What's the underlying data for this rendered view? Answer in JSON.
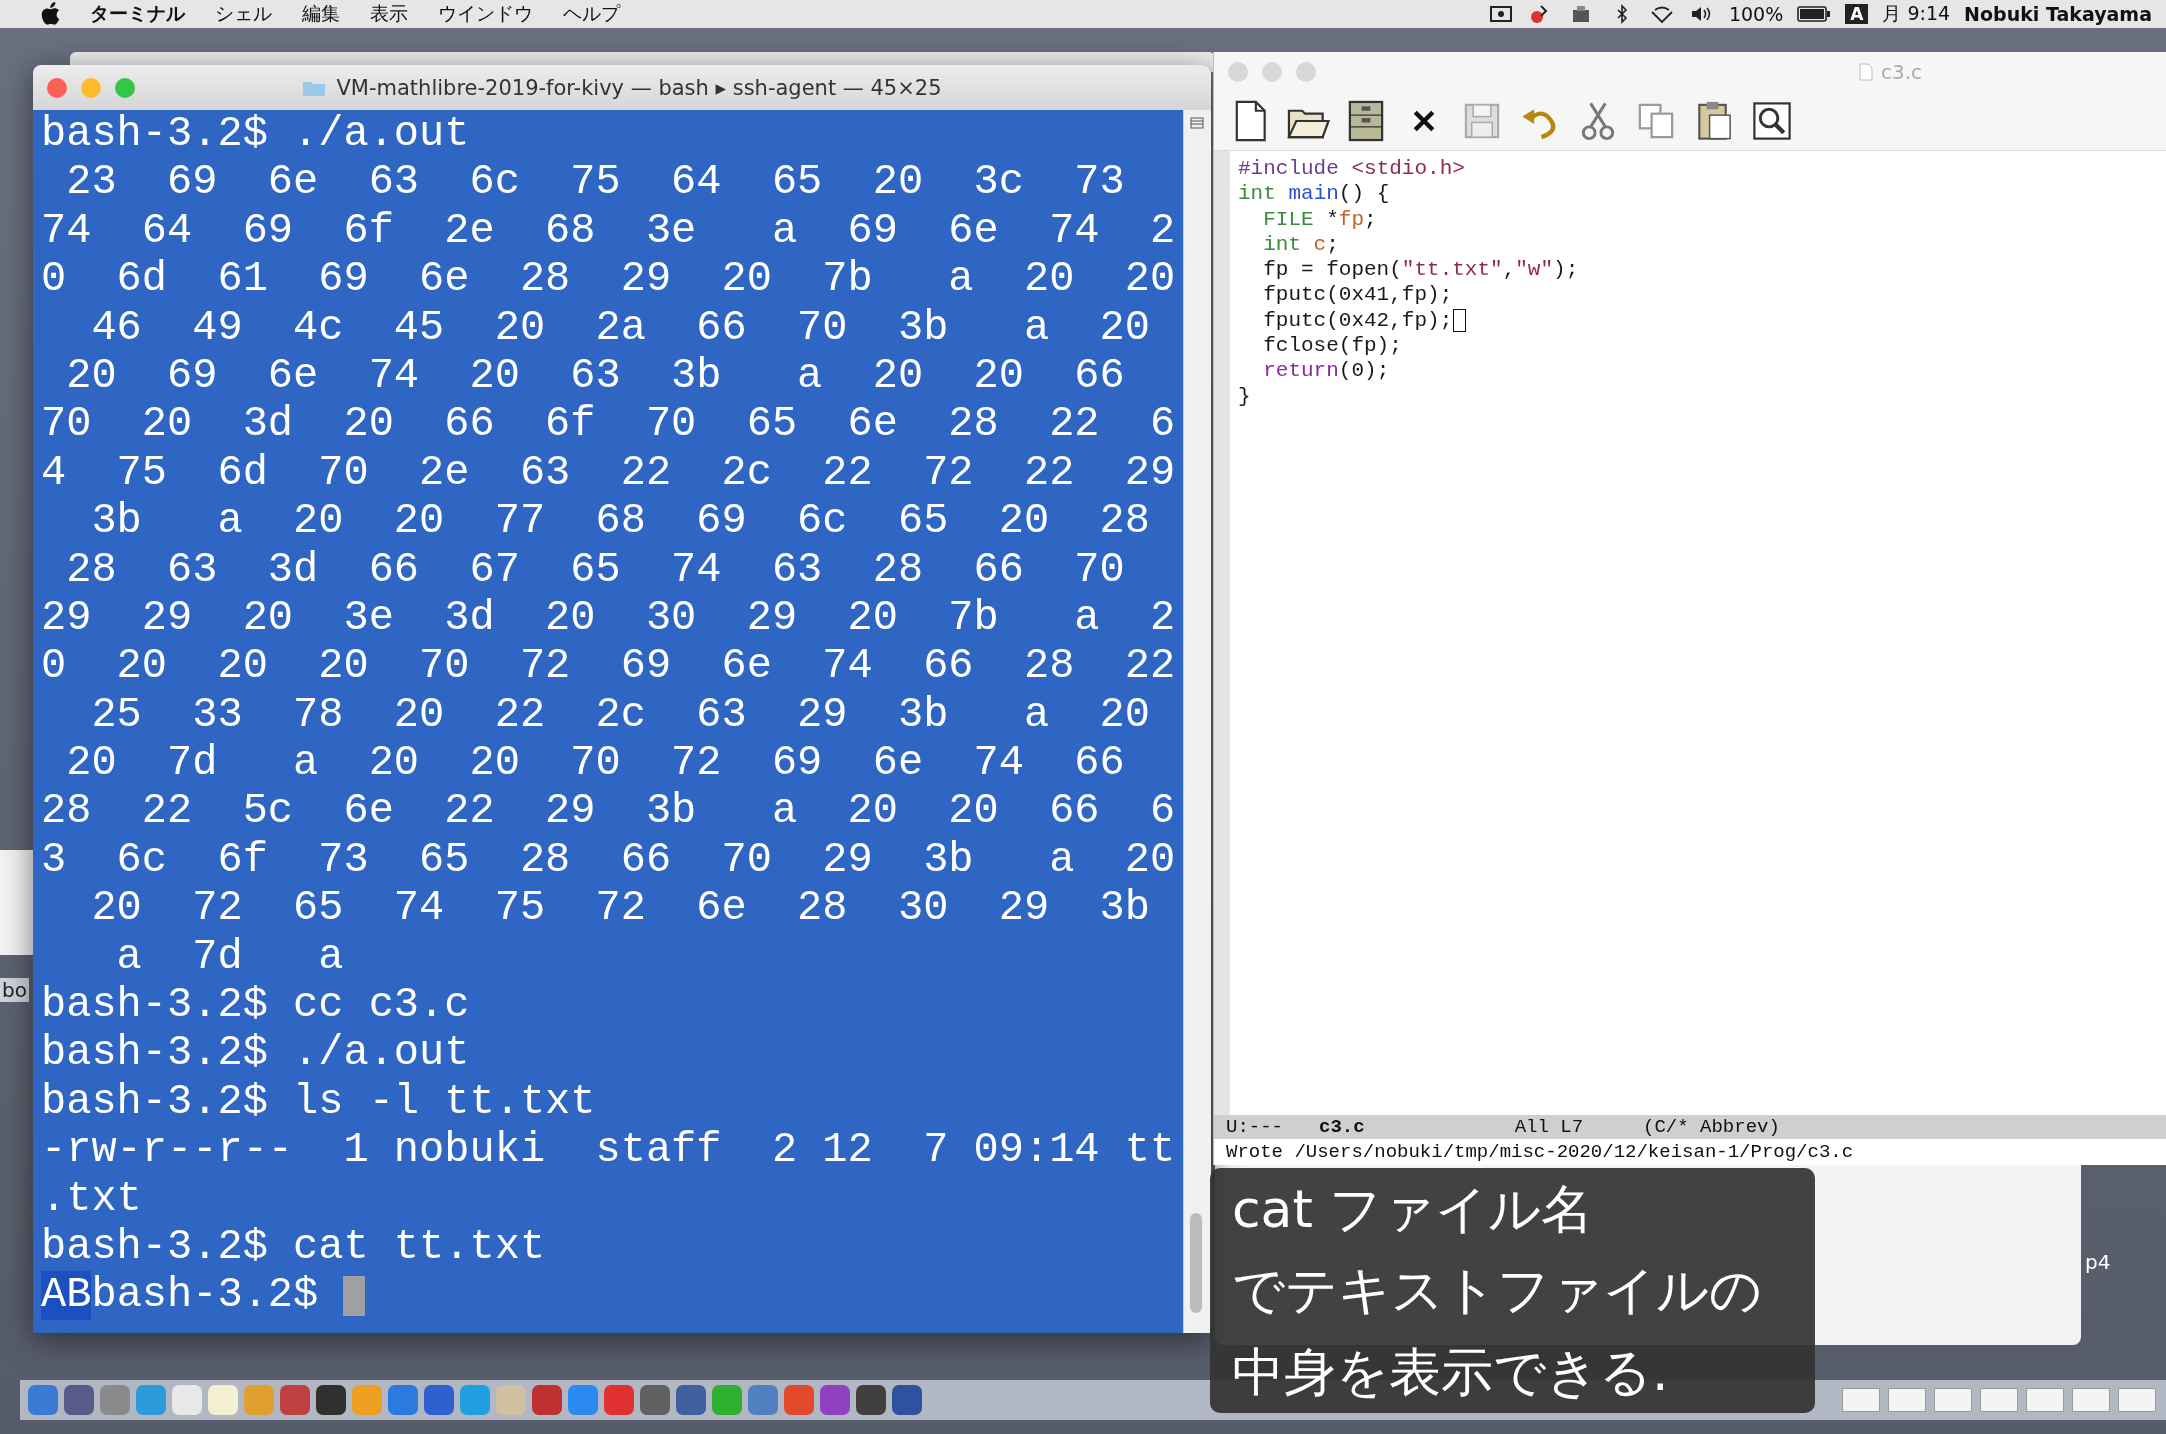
{
  "menu_bar": {
    "app_name": "ターミナル",
    "menus": [
      "シェル",
      "編集",
      "表示",
      "ウインドウ",
      "ヘルプ"
    ],
    "battery": "100%",
    "input_mode": "A",
    "clock": "月 9:14",
    "user": "Nobuki Takayama"
  },
  "terminal": {
    "title": "VM-mathlibre-2019-for-kivy — bash ▸ ssh-agent — 45×25",
    "lines": [
      "bash-3.2$ ./a.out",
      " 23  69  6e  63  6c  75  64  65  20  3c  73",
      "74  64  69  6f  2e  68  3e   a  69  6e  74  2",
      "0  6d  61  69  6e  28  29  20  7b   a  20  20",
      "  46  49  4c  45  20  2a  66  70  3b   a  20",
      " 20  69  6e  74  20  63  3b   a  20  20  66",
      "70  20  3d  20  66  6f  70  65  6e  28  22  6",
      "4  75  6d  70  2e  63  22  2c  22  72  22  29",
      "  3b   a  20  20  77  68  69  6c  65  20  28",
      " 28  63  3d  66  67  65  74  63  28  66  70",
      "29  29  20  3e  3d  20  30  29  20  7b   a  2",
      "0  20  20  20  70  72  69  6e  74  66  28  22",
      "  25  33  78  20  22  2c  63  29  3b   a  20",
      " 20  7d   a  20  20  70  72  69  6e  74  66",
      "28  22  5c  6e  22  29  3b   a  20  20  66  6",
      "3  6c  6f  73  65  28  66  70  29  3b   a  20",
      "  20  72  65  74  75  72  6e  28  30  29  3b",
      "   a  7d   a",
      "bash-3.2$ cc c3.c",
      "bash-3.2$ ./a.out",
      "bash-3.2$ ls -l tt.txt",
      "-rw-r--r--  1 nobuki  staff  2 12  7 09:14 tt",
      ".txt",
      "bash-3.2$ cat tt.txt"
    ],
    "input_line": {
      "segments": [
        {
          "text": "AB",
          "selected": true
        },
        {
          "text": "bash-3.2$",
          "selected": false
        }
      ],
      "cursor": true
    }
  },
  "editor": {
    "title": "c3.c",
    "code_lines": [
      {
        "segments": [
          {
            "kind": "preproc",
            "text": "#include "
          },
          {
            "kind": "string",
            "text": "<stdio.h>"
          }
        ],
        "cursor": false
      },
      {
        "segments": [
          {
            "kind": "type",
            "text": "int "
          },
          {
            "kind": "function",
            "text": "main"
          },
          {
            "kind": "plain",
            "text": "() {"
          }
        ],
        "cursor": false
      },
      {
        "segments": [
          {
            "kind": "type",
            "text": "  FILE"
          },
          {
            "kind": "plain",
            "text": " *"
          },
          {
            "kind": "variable",
            "text": "fp"
          },
          {
            "kind": "plain",
            "text": ";"
          }
        ],
        "cursor": false
      },
      {
        "segments": [
          {
            "kind": "type",
            "text": "  int"
          },
          {
            "kind": "variable",
            "text": " c"
          },
          {
            "kind": "plain",
            "text": ";"
          }
        ],
        "cursor": false
      },
      {
        "segments": [
          {
            "kind": "plain",
            "text": "  fp = fopen("
          },
          {
            "kind": "string",
            "text": "\"tt.txt\""
          },
          {
            "kind": "plain",
            "text": ","
          },
          {
            "kind": "string",
            "text": "\"w\""
          },
          {
            "kind": "plain",
            "text": ");"
          }
        ],
        "cursor": false
      },
      {
        "segments": [
          {
            "kind": "plain",
            "text": "  fputc(0x41,fp);"
          }
        ],
        "cursor": false
      },
      {
        "segments": [
          {
            "kind": "plain",
            "text": "  fputc(0x42,fp);"
          }
        ],
        "cursor": true
      },
      {
        "segments": [
          {
            "kind": "plain",
            "text": "  fclose(fp);"
          }
        ],
        "cursor": false
      },
      {
        "segments": [
          {
            "kind": "keyword",
            "text": "  return"
          },
          {
            "kind": "plain",
            "text": "(0);"
          }
        ],
        "cursor": false
      },
      {
        "segments": [
          {
            "kind": "plain",
            "text": "}"
          }
        ],
        "cursor": false
      }
    ],
    "mode_line": {
      "status": "U:---",
      "buffer": "c3.c",
      "position": "All L7",
      "mode": "(C/* Abbrev)"
    },
    "minibuffer": "Wrote /Users/nobuki/tmp/misc-2020/12/keisan-1/Prog/c3.c"
  },
  "subtitle": [
    "cat ファイル名",
    "でテキストファイルの",
    "中身を表示できる."
  ],
  "desktop_labels": [
    "bo",
    "p4"
  ]
}
